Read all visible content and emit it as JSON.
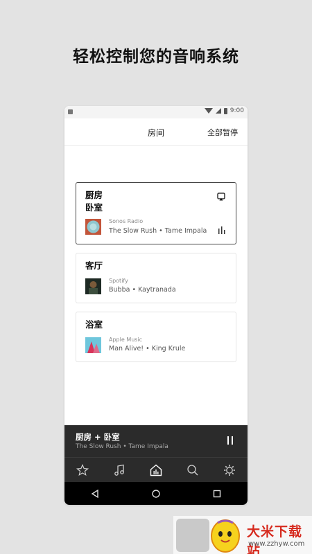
{
  "headline": "轻松控制您的音响系统",
  "status": {
    "time": "9:00"
  },
  "header": {
    "title": "房间",
    "pause_all": "全部暂停"
  },
  "rooms": [
    {
      "name_lines": [
        "厨房",
        "卧室"
      ],
      "source": "Sonos Radio",
      "track": "The Slow Rush • Tame Impala",
      "selected": true
    },
    {
      "name_lines": [
        "客厅"
      ],
      "source": "Spotify",
      "track": "Bubba • Kaytranada",
      "selected": false
    },
    {
      "name_lines": [
        "浴室"
      ],
      "source": "Apple Music",
      "track": "Man Alive! • King Krule",
      "selected": false
    }
  ],
  "now_playing": {
    "title": "厨房 + 卧室",
    "subtitle": "The Slow Rush • Tame Impala"
  },
  "tabs": [
    {
      "name": "favorites",
      "icon": "star-icon"
    },
    {
      "name": "music",
      "icon": "music-note-icon"
    },
    {
      "name": "rooms",
      "icon": "home-icon",
      "active": true
    },
    {
      "name": "search",
      "icon": "search-icon"
    },
    {
      "name": "settings",
      "icon": "gear-icon"
    }
  ],
  "system_nav": [
    "back-icon",
    "home-circle-icon",
    "recents-icon"
  ],
  "watermark": {
    "name": "大米下载站",
    "url": "www.zzhyw.com"
  },
  "colors": {
    "accent_dark": "#2b2b2b",
    "background": "#e3e3e3",
    "watermark_red": "#d62a1e"
  }
}
